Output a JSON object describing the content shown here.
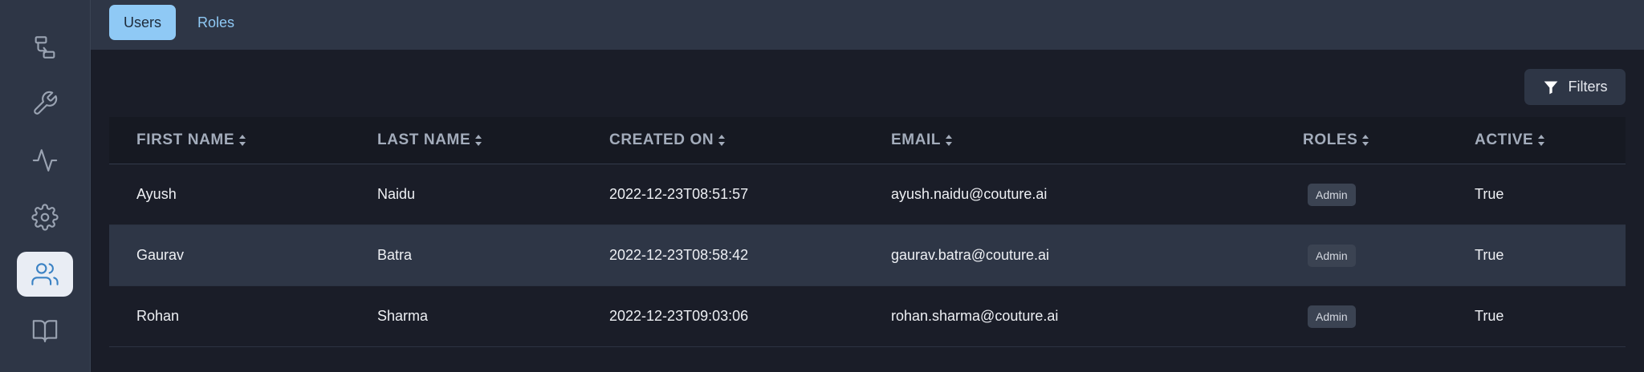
{
  "sidebar": {
    "items": [
      {
        "icon": "flow-icon",
        "active": false
      },
      {
        "icon": "wrench-icon",
        "active": false
      },
      {
        "icon": "activity-icon",
        "active": false
      },
      {
        "icon": "gear-icon",
        "active": false
      },
      {
        "icon": "users-icon",
        "active": true
      },
      {
        "icon": "book-icon",
        "active": false
      }
    ]
  },
  "tabs": [
    {
      "label": "Users",
      "active": true
    },
    {
      "label": "Roles",
      "active": false
    }
  ],
  "filters_label": "Filters",
  "table": {
    "columns": [
      "FIRST NAME",
      "LAST NAME",
      "CREATED ON",
      "EMAIL",
      "ROLES",
      "ACTIVE"
    ],
    "rows": [
      {
        "first_name": "Ayush",
        "last_name": "Naidu",
        "created_on": "2022-12-23T08:51:57",
        "email": "ayush.naidu@couture.ai",
        "role": "Admin",
        "active": "True"
      },
      {
        "first_name": "Gaurav",
        "last_name": "Batra",
        "created_on": "2022-12-23T08:58:42",
        "email": "gaurav.batra@couture.ai",
        "role": "Admin",
        "active": "True"
      },
      {
        "first_name": "Rohan",
        "last_name": "Sharma",
        "created_on": "2022-12-23T09:03:06",
        "email": "rohan.sharma@couture.ai",
        "role": "Admin",
        "active": "True"
      }
    ]
  },
  "colors": {
    "sidebar_bg": "#2e3646",
    "main_bg": "#1a1d28",
    "accent": "#8fc9f5",
    "active_nav_bg": "#e9edf4",
    "active_nav_icon": "#3b82c4"
  }
}
